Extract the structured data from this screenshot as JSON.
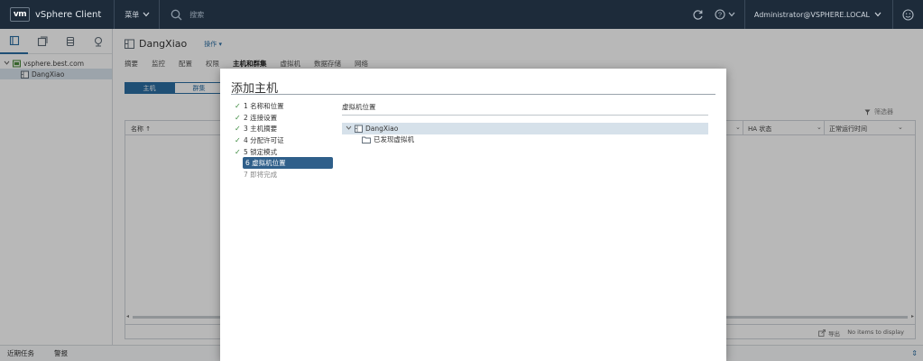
{
  "header": {
    "logo": "vm",
    "app_title": "vSphere Client",
    "menu_label": "菜单",
    "search_placeholder": "搜索",
    "user": "Administrator@VSPHERE.LOCAL"
  },
  "nav": {
    "tree": [
      {
        "label": "vsphere.best.com",
        "icon": "vcenter-icon"
      },
      {
        "label": "DangXiao",
        "icon": "datacenter-icon"
      }
    ]
  },
  "main": {
    "object_title": "DangXiao",
    "actions_label": "操作",
    "tabs": [
      "摘要",
      "监控",
      "配置",
      "权限",
      "主机和群集",
      "虚拟机",
      "数据存储",
      "网络"
    ],
    "segments": [
      "主机",
      "群集"
    ],
    "filter_label": "筛选器",
    "columns": [
      "名称 ↑",
      "HA 状态",
      "正常运行时间"
    ],
    "footer_export": "导出",
    "footer_status": "No items to display"
  },
  "bottom": {
    "recent_tasks": "近期任务",
    "alarms": "警报"
  },
  "modal": {
    "title": "添加主机",
    "steps": [
      {
        "label": "1 名称和位置",
        "state": "done"
      },
      {
        "label": "2 连接设置",
        "state": "done"
      },
      {
        "label": "3 主机摘要",
        "state": "done"
      },
      {
        "label": "4 分配许可证",
        "state": "done"
      },
      {
        "label": "5 锁定模式",
        "state": "done"
      },
      {
        "label": "6 虚拟机位置",
        "state": "current"
      },
      {
        "label": "7 即将完成",
        "state": "pending"
      }
    ],
    "panel_title": "虚拟机位置",
    "tree": [
      {
        "label": "DangXiao",
        "icon": "datacenter-icon"
      },
      {
        "label": "已发现虚拟机",
        "icon": "folder-icon"
      }
    ]
  },
  "colors": {
    "header_bg": "#1d2b3a",
    "accent": "#2c6ea3",
    "current_step": "#2f5f8a",
    "check": "#3c8a3e"
  }
}
